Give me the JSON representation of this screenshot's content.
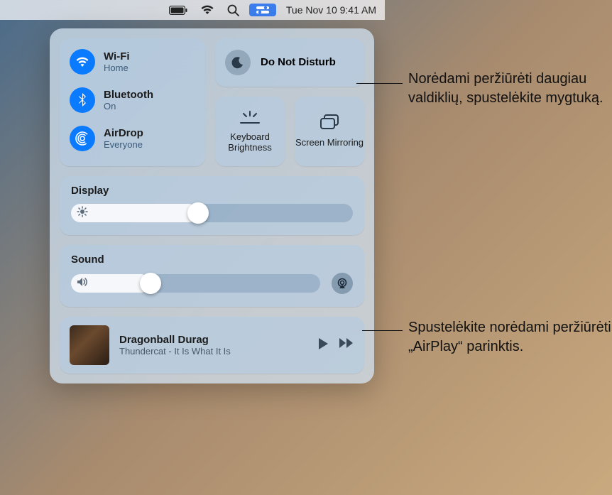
{
  "menubar": {
    "datetime": "Tue Nov 10  9:41 AM"
  },
  "control_center": {
    "wifi": {
      "title": "Wi-Fi",
      "status": "Home"
    },
    "bluetooth": {
      "title": "Bluetooth",
      "status": "On"
    },
    "airdrop": {
      "title": "AirDrop",
      "status": "Everyone"
    },
    "dnd": {
      "title": "Do Not Disturb"
    },
    "keyboard_brightness": {
      "label": "Keyboard Brightness"
    },
    "screen_mirroring": {
      "label": "Screen Mirroring"
    },
    "display": {
      "title": "Display",
      "value_pct": 45
    },
    "sound": {
      "title": "Sound",
      "value_pct": 32
    },
    "media": {
      "track": "Dragonball Durag",
      "artist_album": "Thundercat - It Is What It Is"
    }
  },
  "callouts": {
    "top": "Norėdami peržiūrėti daugiau valdiklių, spustelėkite mygtuką.",
    "bottom": "Spustelėkite norėdami peržiūrėti „AirPlay“ parinktis."
  }
}
